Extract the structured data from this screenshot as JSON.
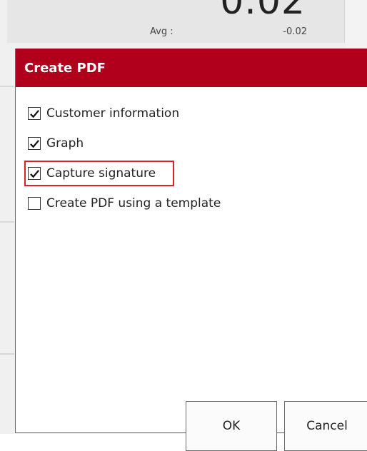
{
  "background": {
    "big_value": "0.02",
    "avg_label": "Avg :",
    "avg_value": "-0.02"
  },
  "dialog": {
    "title": "Create PDF",
    "header_color": "#b0001b",
    "options": [
      {
        "label": "Customer information",
        "checked": true,
        "highlighted": false
      },
      {
        "label": "Graph",
        "checked": true,
        "highlighted": false
      },
      {
        "label": "Capture signature",
        "checked": true,
        "highlighted": true
      },
      {
        "label": "Create PDF using a template",
        "checked": false,
        "highlighted": false
      }
    ],
    "highlight_color": "#d8232a",
    "ok_label": "OK",
    "cancel_label": "Cancel"
  }
}
